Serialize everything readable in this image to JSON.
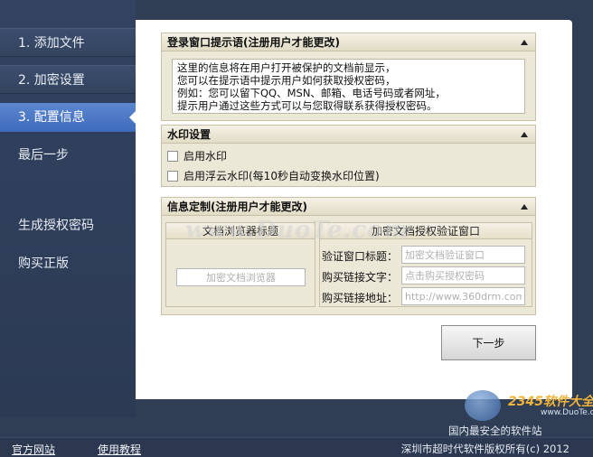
{
  "sidebar": {
    "items": [
      {
        "label": "1. 添加文件"
      },
      {
        "label": "2. 加密设置"
      },
      {
        "label": "3. 配置信息"
      },
      {
        "label": "最后一步"
      },
      {
        "label": "生成授权密码"
      },
      {
        "label": "购买正版"
      }
    ]
  },
  "login_hint": {
    "title": "登录窗口提示语(注册用户才能更改)",
    "lines": [
      "这里的信息将在用户打开被保护的文档前显示，",
      "您可以在提示语中提示用户如何获取授权密码，",
      "例如：您可以留下QQ、MSN、邮箱、电话号码或者网址，",
      "提示用户通过这些方式可以与您取得联系获得授权密码。"
    ]
  },
  "watermark": {
    "title": "水印设置",
    "enable_label": "启用水印",
    "floating_label": "启用浮云水印(每10秒自动变换水印位置)"
  },
  "custom_info": {
    "title": "信息定制(注册用户才能更改)",
    "browser_title": "文档浏览器标题",
    "browser_placeholder": "加密文档浏览器",
    "verify_title": "加密文档授权验证窗口",
    "fields": [
      {
        "label": "验证窗口标题：",
        "placeholder": "加密文档验证窗口"
      },
      {
        "label": "购买链接文字：",
        "placeholder": "点击购买授权密码"
      },
      {
        "label": "购买链接地址：",
        "placeholder": "http://www.360drm.com"
      }
    ]
  },
  "next_button": "下一步",
  "footer": {
    "official_site": "官方网站",
    "tutorial": "使用教程",
    "copyright": "深圳市超时代软件版权所有(c) 2012"
  },
  "overlay": {
    "center_watermark": "www.DuoTe.com",
    "brand": "2345软件大全",
    "brand_url": "www.DuoTe.com",
    "slogan": "国内最安全的软件站"
  },
  "colors": {
    "sidebar_bg": "#2f3d55",
    "active_item": "#4a76c6",
    "section_bg": "#ece8d8"
  }
}
